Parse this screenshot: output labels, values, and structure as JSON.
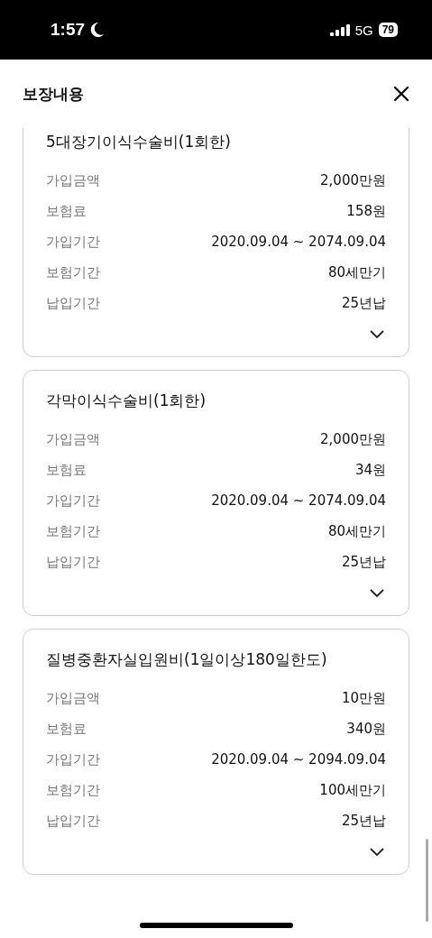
{
  "status_bar": {
    "time": "1:57",
    "network": "5G",
    "battery": "79"
  },
  "header": {
    "title": "보장내용"
  },
  "coverages": [
    {
      "name": "5대장기이식수술비(1회한)",
      "rows": [
        {
          "label": "가입금액",
          "value": "2,000만원"
        },
        {
          "label": "보험료",
          "value": "158원"
        },
        {
          "label": "가입기간",
          "value": "2020.09.04 ~ 2074.09.04"
        },
        {
          "label": "보험기간",
          "value": "80세만기"
        },
        {
          "label": "납입기간",
          "value": "25년납"
        }
      ]
    },
    {
      "name": "각막이식수술비(1회한)",
      "rows": [
        {
          "label": "가입금액",
          "value": "2,000만원"
        },
        {
          "label": "보험료",
          "value": "34원"
        },
        {
          "label": "가입기간",
          "value": "2020.09.04 ~ 2074.09.04"
        },
        {
          "label": "보험기간",
          "value": "80세만기"
        },
        {
          "label": "납입기간",
          "value": "25년납"
        }
      ]
    },
    {
      "name": "질병중환자실입원비(1일이상180일한도)",
      "rows": [
        {
          "label": "가입금액",
          "value": "10만원"
        },
        {
          "label": "보험료",
          "value": "340원"
        },
        {
          "label": "가입기간",
          "value": "2020.09.04 ~ 2094.09.04"
        },
        {
          "label": "보험기간",
          "value": "100세만기"
        },
        {
          "label": "납입기간",
          "value": "25년납"
        }
      ]
    }
  ]
}
